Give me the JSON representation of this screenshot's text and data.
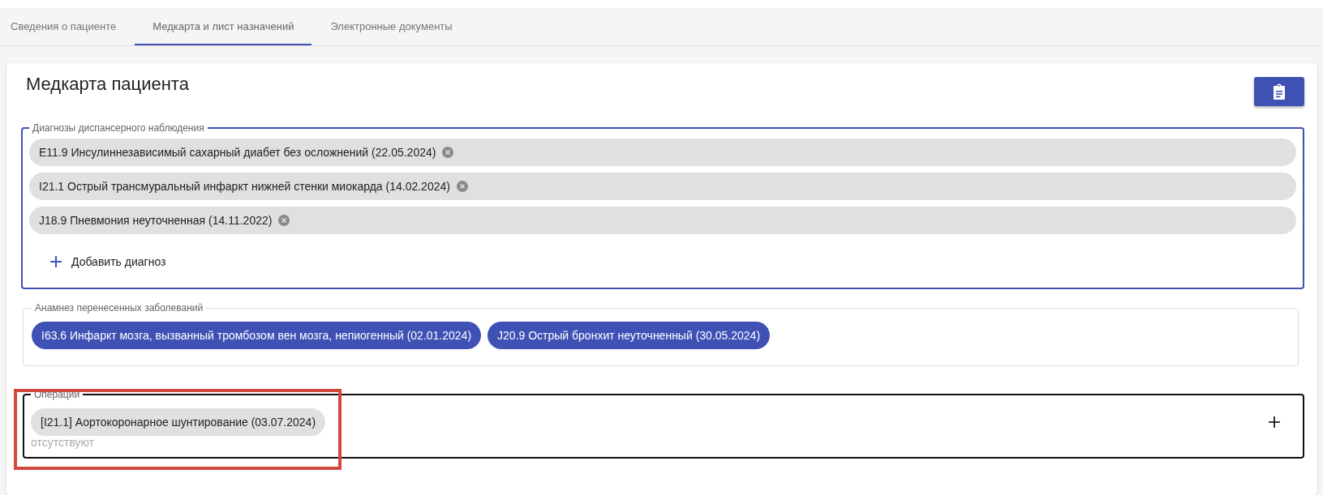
{
  "tabs": [
    {
      "label": "Сведения о пациенте",
      "selected": false
    },
    {
      "label": "Медкарта и лист назначений",
      "selected": true
    },
    {
      "label": "Электронные документы",
      "selected": false
    }
  ],
  "card": {
    "title": "Медкарта пациента",
    "dispensary": {
      "legend": "Диагнозы диспансерного наблюдения",
      "items": [
        {
          "text": "E11.9 Инсулиннезависимый сахарный диабет без осложнений",
          "date": "(22.05.2024)"
        },
        {
          "text": "I21.1 Острый трансмуральный инфаркт нижней стенки миокарда",
          "date": "(14.02.2024)"
        },
        {
          "text": "J18.9 Пневмония неуточненная",
          "date": "(14.11.2022)"
        }
      ],
      "add_label": "Добавить диагноз"
    },
    "anamnesis": {
      "legend": "Анамнез перенесенных заболеваний",
      "items": [
        {
          "text": "I63.6 Инфаркт мозга, вызванный тромбозом вен мозга, непиогенный",
          "date": "(02.01.2024)"
        },
        {
          "text": "J20.9 Острый бронхит неуточненный",
          "date": "(30.05.2024)"
        }
      ]
    },
    "operations": {
      "legend": "Операции",
      "items": [
        {
          "text": "[I21.1] Аортокоронарное шунтирование",
          "date": "(03.07.2024)"
        }
      ],
      "empty_text": "отсутствуют",
      "highlighted": true
    }
  }
}
